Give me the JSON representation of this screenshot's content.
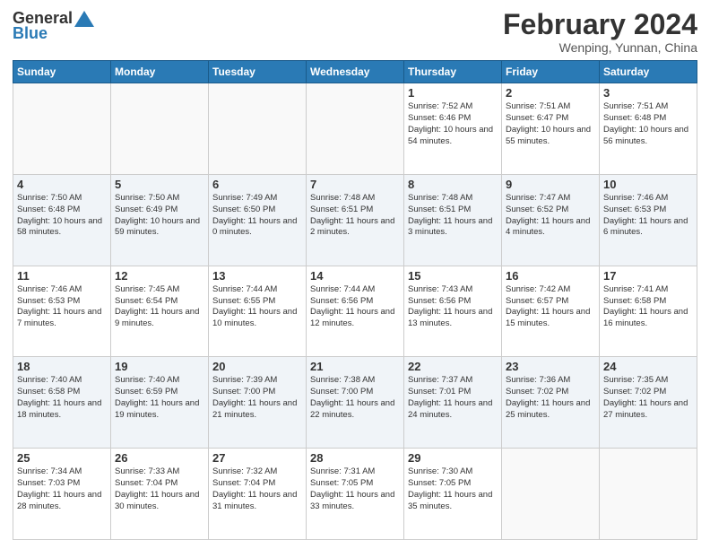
{
  "header": {
    "logo_general": "General",
    "logo_blue": "Blue",
    "month_title": "February 2024",
    "location": "Wenping, Yunnan, China"
  },
  "weekdays": [
    "Sunday",
    "Monday",
    "Tuesday",
    "Wednesday",
    "Thursday",
    "Friday",
    "Saturday"
  ],
  "weeks": [
    [
      {
        "day": "",
        "info": ""
      },
      {
        "day": "",
        "info": ""
      },
      {
        "day": "",
        "info": ""
      },
      {
        "day": "",
        "info": ""
      },
      {
        "day": "1",
        "info": "Sunrise: 7:52 AM\nSunset: 6:46 PM\nDaylight: 10 hours and 54 minutes."
      },
      {
        "day": "2",
        "info": "Sunrise: 7:51 AM\nSunset: 6:47 PM\nDaylight: 10 hours and 55 minutes."
      },
      {
        "day": "3",
        "info": "Sunrise: 7:51 AM\nSunset: 6:48 PM\nDaylight: 10 hours and 56 minutes."
      }
    ],
    [
      {
        "day": "4",
        "info": "Sunrise: 7:50 AM\nSunset: 6:48 PM\nDaylight: 10 hours and 58 minutes."
      },
      {
        "day": "5",
        "info": "Sunrise: 7:50 AM\nSunset: 6:49 PM\nDaylight: 10 hours and 59 minutes."
      },
      {
        "day": "6",
        "info": "Sunrise: 7:49 AM\nSunset: 6:50 PM\nDaylight: 11 hours and 0 minutes."
      },
      {
        "day": "7",
        "info": "Sunrise: 7:48 AM\nSunset: 6:51 PM\nDaylight: 11 hours and 2 minutes."
      },
      {
        "day": "8",
        "info": "Sunrise: 7:48 AM\nSunset: 6:51 PM\nDaylight: 11 hours and 3 minutes."
      },
      {
        "day": "9",
        "info": "Sunrise: 7:47 AM\nSunset: 6:52 PM\nDaylight: 11 hours and 4 minutes."
      },
      {
        "day": "10",
        "info": "Sunrise: 7:46 AM\nSunset: 6:53 PM\nDaylight: 11 hours and 6 minutes."
      }
    ],
    [
      {
        "day": "11",
        "info": "Sunrise: 7:46 AM\nSunset: 6:53 PM\nDaylight: 11 hours and 7 minutes."
      },
      {
        "day": "12",
        "info": "Sunrise: 7:45 AM\nSunset: 6:54 PM\nDaylight: 11 hours and 9 minutes."
      },
      {
        "day": "13",
        "info": "Sunrise: 7:44 AM\nSunset: 6:55 PM\nDaylight: 11 hours and 10 minutes."
      },
      {
        "day": "14",
        "info": "Sunrise: 7:44 AM\nSunset: 6:56 PM\nDaylight: 11 hours and 12 minutes."
      },
      {
        "day": "15",
        "info": "Sunrise: 7:43 AM\nSunset: 6:56 PM\nDaylight: 11 hours and 13 minutes."
      },
      {
        "day": "16",
        "info": "Sunrise: 7:42 AM\nSunset: 6:57 PM\nDaylight: 11 hours and 15 minutes."
      },
      {
        "day": "17",
        "info": "Sunrise: 7:41 AM\nSunset: 6:58 PM\nDaylight: 11 hours and 16 minutes."
      }
    ],
    [
      {
        "day": "18",
        "info": "Sunrise: 7:40 AM\nSunset: 6:58 PM\nDaylight: 11 hours and 18 minutes."
      },
      {
        "day": "19",
        "info": "Sunrise: 7:40 AM\nSunset: 6:59 PM\nDaylight: 11 hours and 19 minutes."
      },
      {
        "day": "20",
        "info": "Sunrise: 7:39 AM\nSunset: 7:00 PM\nDaylight: 11 hours and 21 minutes."
      },
      {
        "day": "21",
        "info": "Sunrise: 7:38 AM\nSunset: 7:00 PM\nDaylight: 11 hours and 22 minutes."
      },
      {
        "day": "22",
        "info": "Sunrise: 7:37 AM\nSunset: 7:01 PM\nDaylight: 11 hours and 24 minutes."
      },
      {
        "day": "23",
        "info": "Sunrise: 7:36 AM\nSunset: 7:02 PM\nDaylight: 11 hours and 25 minutes."
      },
      {
        "day": "24",
        "info": "Sunrise: 7:35 AM\nSunset: 7:02 PM\nDaylight: 11 hours and 27 minutes."
      }
    ],
    [
      {
        "day": "25",
        "info": "Sunrise: 7:34 AM\nSunset: 7:03 PM\nDaylight: 11 hours and 28 minutes."
      },
      {
        "day": "26",
        "info": "Sunrise: 7:33 AM\nSunset: 7:04 PM\nDaylight: 11 hours and 30 minutes."
      },
      {
        "day": "27",
        "info": "Sunrise: 7:32 AM\nSunset: 7:04 PM\nDaylight: 11 hours and 31 minutes."
      },
      {
        "day": "28",
        "info": "Sunrise: 7:31 AM\nSunset: 7:05 PM\nDaylight: 11 hours and 33 minutes."
      },
      {
        "day": "29",
        "info": "Sunrise: 7:30 AM\nSunset: 7:05 PM\nDaylight: 11 hours and 35 minutes."
      },
      {
        "day": "",
        "info": ""
      },
      {
        "day": "",
        "info": ""
      }
    ]
  ]
}
